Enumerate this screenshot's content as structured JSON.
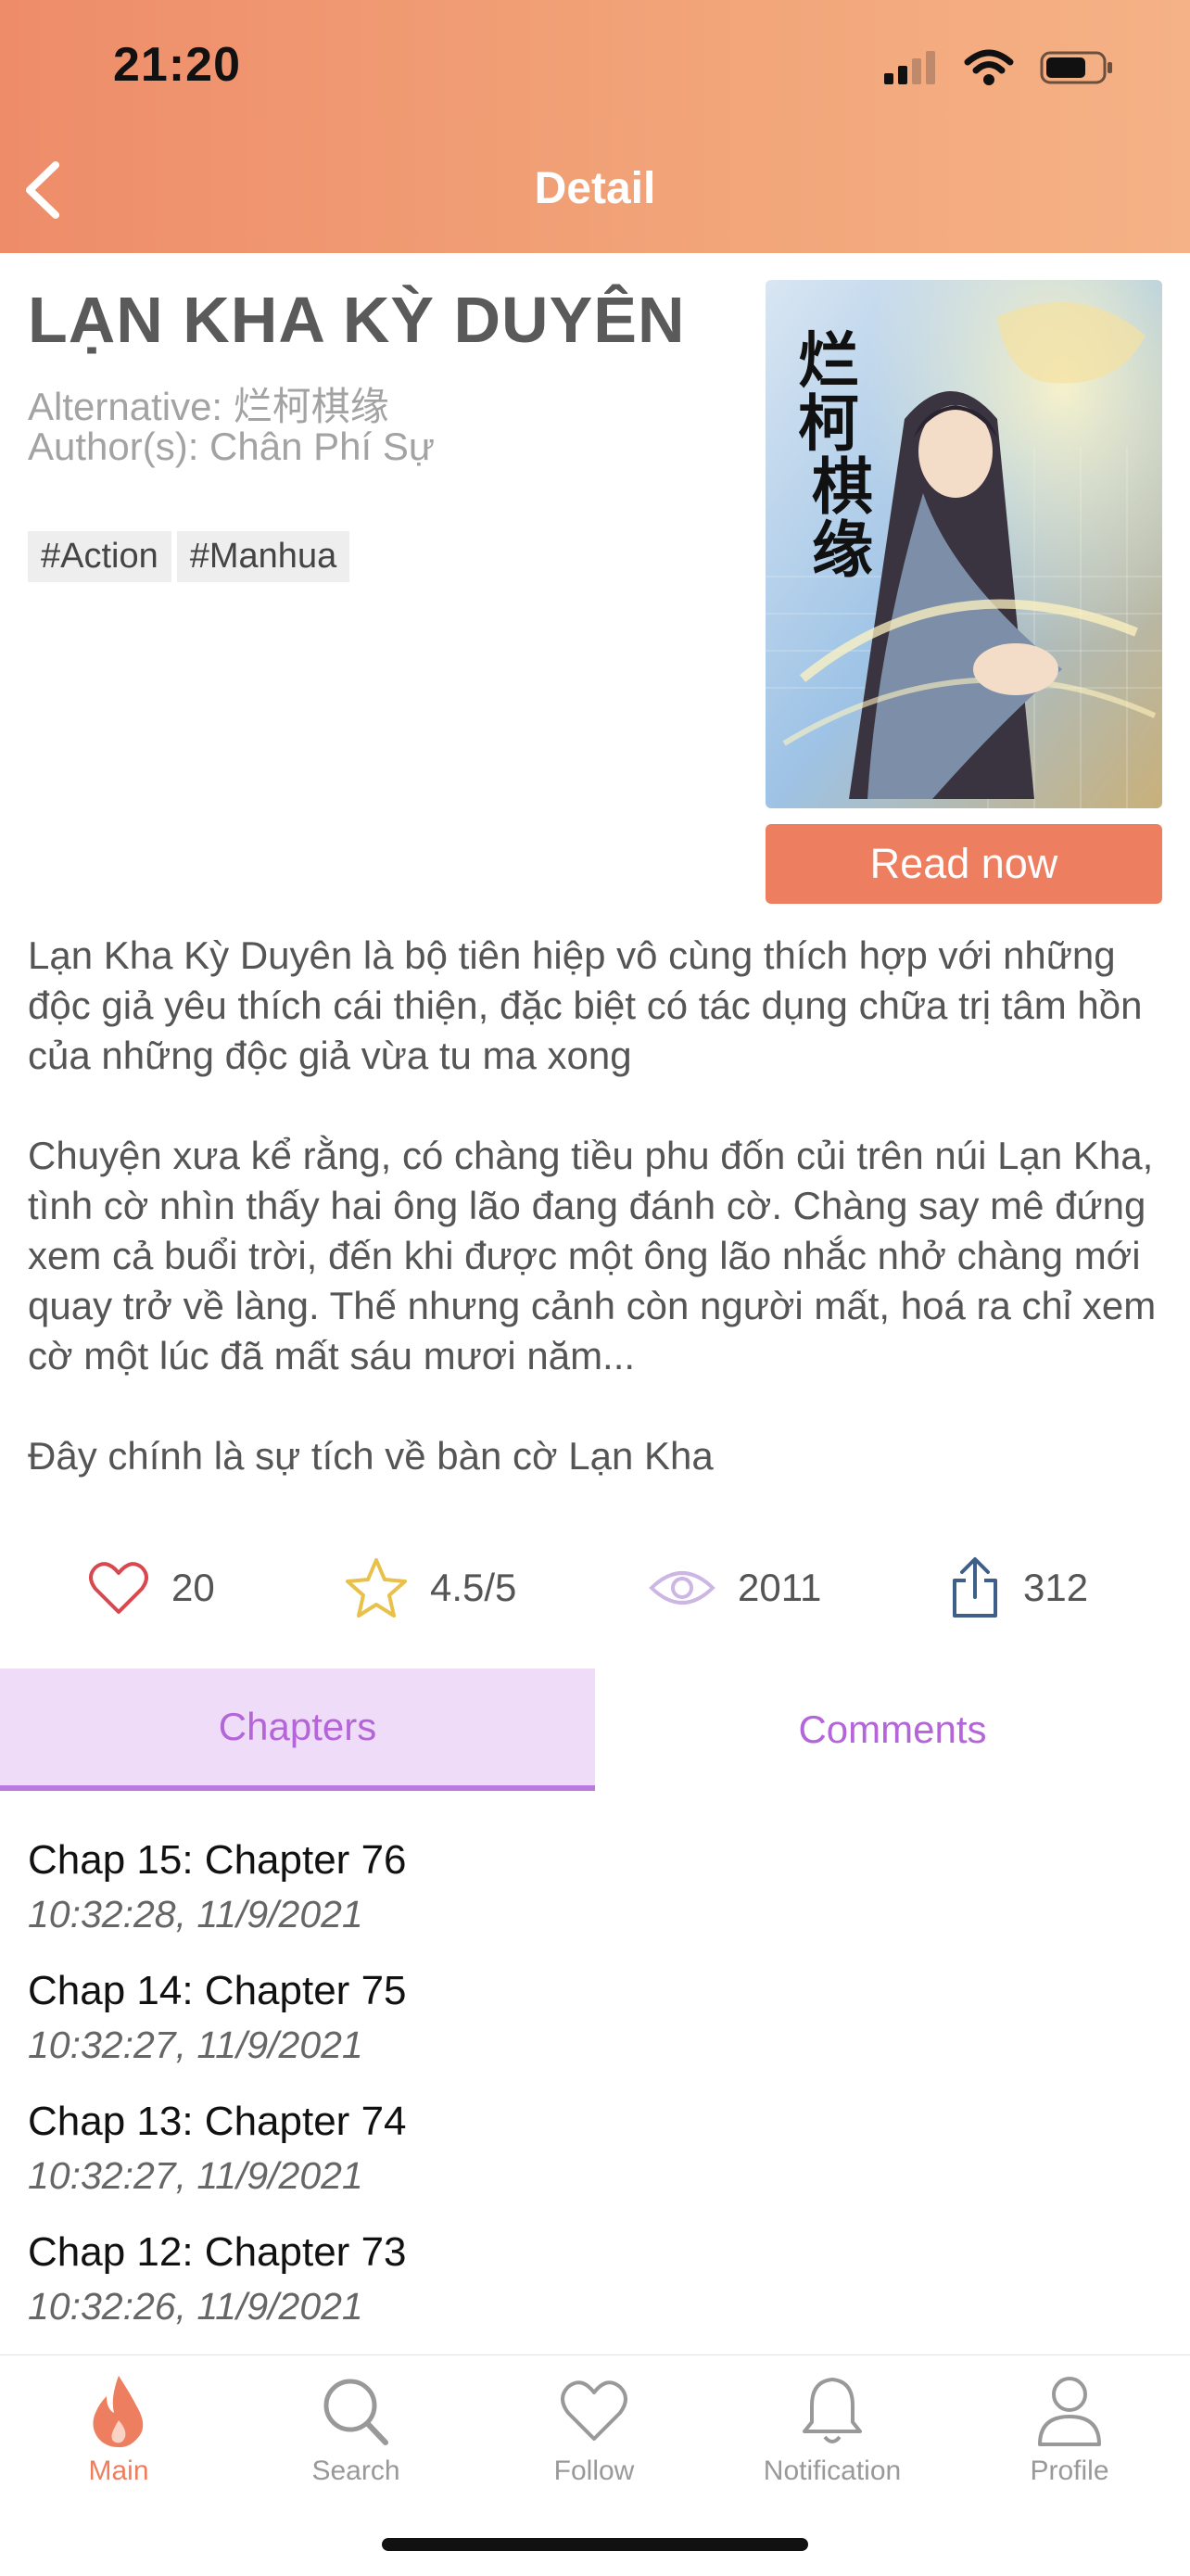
{
  "status_bar": {
    "time": "21:20"
  },
  "header": {
    "title": "Detail",
    "back_icon": "chevron-left-icon"
  },
  "manga": {
    "title": "LẠN KHA KỲ DUYÊN",
    "alternative": "Alternative:  烂柯棋缘",
    "author": "Author(s): Chân Phí Sự",
    "tags": [
      "#Action",
      "#Manhua"
    ],
    "cover_text": "烂柯棋缘",
    "read_button": "Read now",
    "description": [
      "Lạn Kha Kỳ Duyên là bộ tiên hiệp vô cùng thích hợp với những độc giả yêu thích cái thiện, đặc biệt có tác dụng chữa trị tâm hồn của những độc giả vừa tu ma xong",
      "Chuyện xưa kể rằng, có chàng tiều phu đốn củi trên núi Lạn Kha, tình cờ nhìn thấy hai ông lão đang đánh cờ. Chàng say mê đứng xem cả buổi trời, đến khi được một ông lão nhắc nhở chàng mới quay trở về làng. Thế nhưng cảnh còn người mất, hoá ra chỉ xem cờ một lúc đã mất sáu mươi năm...",
      "Đây chính là sự tích về bàn cờ Lạn Kha"
    ]
  },
  "stats": {
    "likes": "20",
    "rating": "4.5/5",
    "views": "2011",
    "shares": "312"
  },
  "tabs": {
    "chapters": "Chapters",
    "comments": "Comments",
    "active": "chapters"
  },
  "chapters": [
    {
      "title": "Chap 15: Chapter 76",
      "time": "10:32:28, 11/9/2021"
    },
    {
      "title": "Chap 14: Chapter 75",
      "time": "10:32:27, 11/9/2021"
    },
    {
      "title": "Chap 13: Chapter 74",
      "time": "10:32:27, 11/9/2021"
    },
    {
      "title": "Chap 12: Chapter 73",
      "time": "10:32:26, 11/9/2021"
    }
  ],
  "tabbar": [
    {
      "label": "Main",
      "icon": "flame-icon",
      "active": true
    },
    {
      "label": "Search",
      "icon": "search-icon",
      "active": false
    },
    {
      "label": "Follow",
      "icon": "heart-icon",
      "active": false
    },
    {
      "label": "Notification",
      "icon": "bell-icon",
      "active": false
    },
    {
      "label": "Profile",
      "icon": "person-icon",
      "active": false
    }
  ],
  "colors": {
    "accent": "#ee7e60",
    "header_start": "#ee8c6a",
    "header_end": "#f5b286",
    "tab_active_bg": "#efdcf8",
    "tab_text": "#b466d8"
  }
}
